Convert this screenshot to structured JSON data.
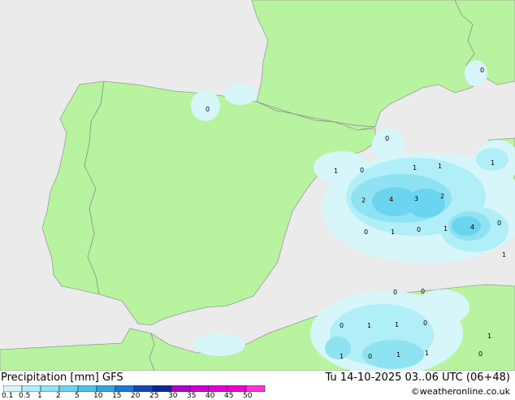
{
  "map": {
    "contour_labels": [
      "0",
      "0",
      "0",
      "1",
      "0",
      "1",
      "1",
      "2",
      "4",
      "3",
      "2",
      "0",
      "1",
      "0",
      "1",
      "4",
      "0",
      "1",
      "0",
      "0",
      "0",
      "1",
      "1",
      "0",
      "1",
      "0",
      "1",
      "1",
      "1",
      "0",
      "1"
    ]
  },
  "legend": {
    "product": "Precipitation [mm]",
    "model": "GFS",
    "title_text": "Precipitation [mm]  GFS",
    "ticks": [
      "0.1",
      "0.5",
      "1",
      "2",
      "5",
      "10",
      "15",
      "20",
      "25",
      "30",
      "35",
      "40",
      "45",
      "50"
    ],
    "colors": [
      "#d6f6fa",
      "#b0eef8",
      "#8ee2f2",
      "#6bd4ee",
      "#4dc4e6",
      "#2fa8de",
      "#1e78d6",
      "#1448b8",
      "#0c2896",
      "#b000ca",
      "#cd00d8",
      "#e000d8",
      "#f200d2",
      "#ff30d8"
    ]
  },
  "valid_time": "Tu 14-10-2025 03..06 UTC (06+48)",
  "credit": "©weatheronline.co.uk",
  "colors": {
    "land": "#b8f4a0",
    "sea": "#ebebeb",
    "border": "#8a8a8a"
  }
}
